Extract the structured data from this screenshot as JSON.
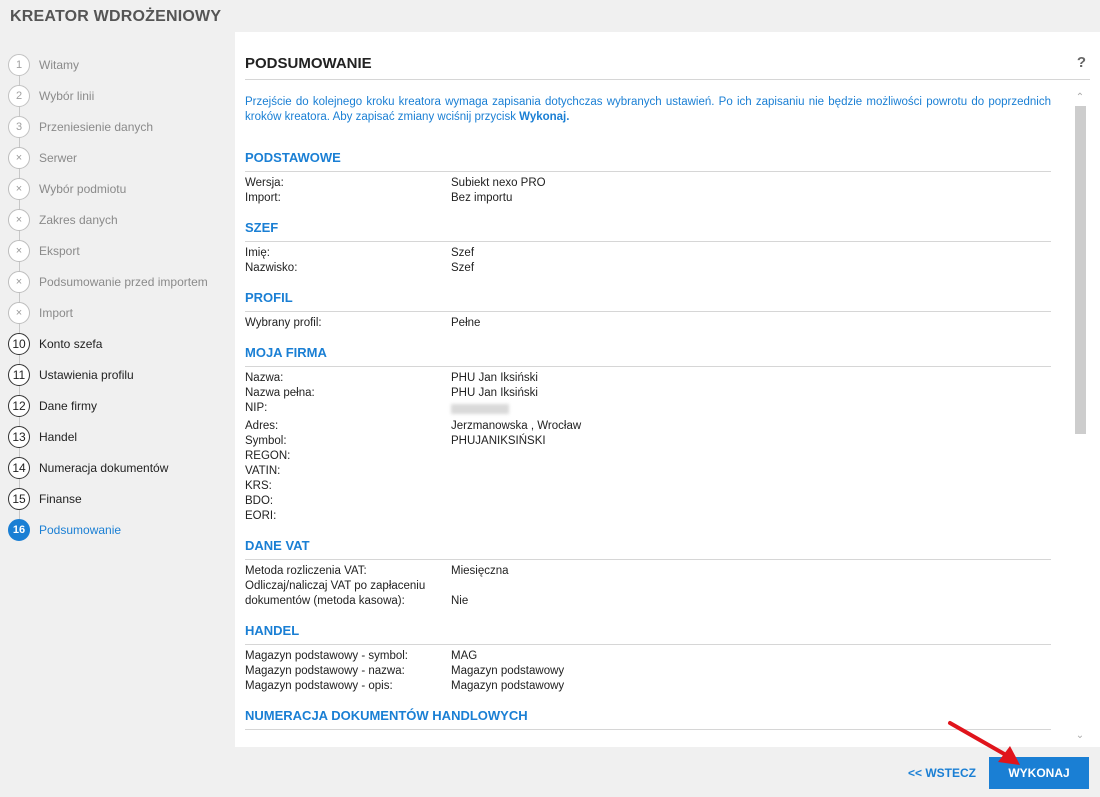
{
  "app": {
    "title": "KREATOR WDROŻENIOWY"
  },
  "steps": [
    {
      "num": "1",
      "label": "Witamy",
      "state": "done"
    },
    {
      "num": "2",
      "label": "Wybór linii",
      "state": "done"
    },
    {
      "num": "3",
      "label": "Przeniesienie danych",
      "state": "done"
    },
    {
      "num": "×",
      "label": "Serwer",
      "state": "skipped"
    },
    {
      "num": "×",
      "label": "Wybór podmiotu",
      "state": "skipped"
    },
    {
      "num": "×",
      "label": "Zakres danych",
      "state": "skipped"
    },
    {
      "num": "×",
      "label": "Eksport",
      "state": "skipped"
    },
    {
      "num": "×",
      "label": "Podsumowanie przed importem",
      "state": "skipped"
    },
    {
      "num": "×",
      "label": "Import",
      "state": "skipped"
    },
    {
      "num": "10",
      "label": "Konto szefa",
      "state": "active"
    },
    {
      "num": "11",
      "label": "Ustawienia profilu",
      "state": "active"
    },
    {
      "num": "12",
      "label": "Dane firmy",
      "state": "active"
    },
    {
      "num": "13",
      "label": "Handel",
      "state": "active"
    },
    {
      "num": "14",
      "label": "Numeracja dokumentów",
      "state": "active"
    },
    {
      "num": "15",
      "label": "Finanse",
      "state": "active"
    },
    {
      "num": "16",
      "label": "Podsumowanie",
      "state": "current"
    }
  ],
  "panel": {
    "title": "PODSUMOWANIE",
    "help": "?",
    "intro_text": "Przejście do kolejnego kroku kreatora wymaga zapisania dotychczas wybranych ustawień. Po ich zapisaniu nie będzie możliwości powrotu do poprzednich kroków kreatora. Aby zapisać zmiany wciśnij przycisk ",
    "intro_bold": "Wykonaj."
  },
  "sections": [
    {
      "title": "PODSTAWOWE",
      "rows": [
        {
          "k": "Wersja:",
          "v": "Subiekt nexo PRO"
        },
        {
          "k": "Import:",
          "v": "Bez importu"
        }
      ]
    },
    {
      "title": "SZEF",
      "rows": [
        {
          "k": "Imię:",
          "v": "Szef"
        },
        {
          "k": "Nazwisko:",
          "v": "Szef"
        }
      ]
    },
    {
      "title": "PROFIL",
      "rows": [
        {
          "k": "Wybrany profil:",
          "v": "Pełne"
        }
      ]
    },
    {
      "title": "MOJA FIRMA",
      "rows": [
        {
          "k": "Nazwa:",
          "v": "PHU Jan Iksiński"
        },
        {
          "k": "Nazwa pełna:",
          "v": "PHU Jan Iksiński"
        },
        {
          "k": "NIP:",
          "v": "",
          "blurred": true
        },
        {
          "k": "Adres:",
          "v": "Jerzmanowska ,  Wrocław"
        },
        {
          "k": "Symbol:",
          "v": "PHUJANIKSIŃSKI"
        },
        {
          "k": "REGON:",
          "v": ""
        },
        {
          "k": "VATIN:",
          "v": ""
        },
        {
          "k": "KRS:",
          "v": ""
        },
        {
          "k": "BDO:",
          "v": ""
        },
        {
          "k": "EORI:",
          "v": ""
        }
      ]
    },
    {
      "title": "DANE VAT",
      "rows": [
        {
          "k": "Metoda rozliczenia VAT:",
          "v": "Miesięczna"
        },
        {
          "k": "Odliczaj/naliczaj VAT po zapłaceniu",
          "v": ""
        },
        {
          "k": "dokumentów (metoda kasowa):",
          "v": "Nie"
        }
      ]
    },
    {
      "title": "HANDEL",
      "rows": [
        {
          "k": "Magazyn podstawowy - symbol:",
          "v": "MAG"
        },
        {
          "k": "Magazyn podstawowy - nazwa:",
          "v": "Magazyn podstawowy"
        },
        {
          "k": "Magazyn podstawowy - opis:",
          "v": "Magazyn podstawowy"
        }
      ]
    },
    {
      "title": "NUMERACJA DOKUMENTÓW HANDLOWYCH",
      "rows": []
    }
  ],
  "buttons": {
    "back": "<< WSTECZ",
    "execute": "WYKONAJ"
  },
  "colors": {
    "accent": "#1a7fd4",
    "arrow": "#e0141c"
  }
}
